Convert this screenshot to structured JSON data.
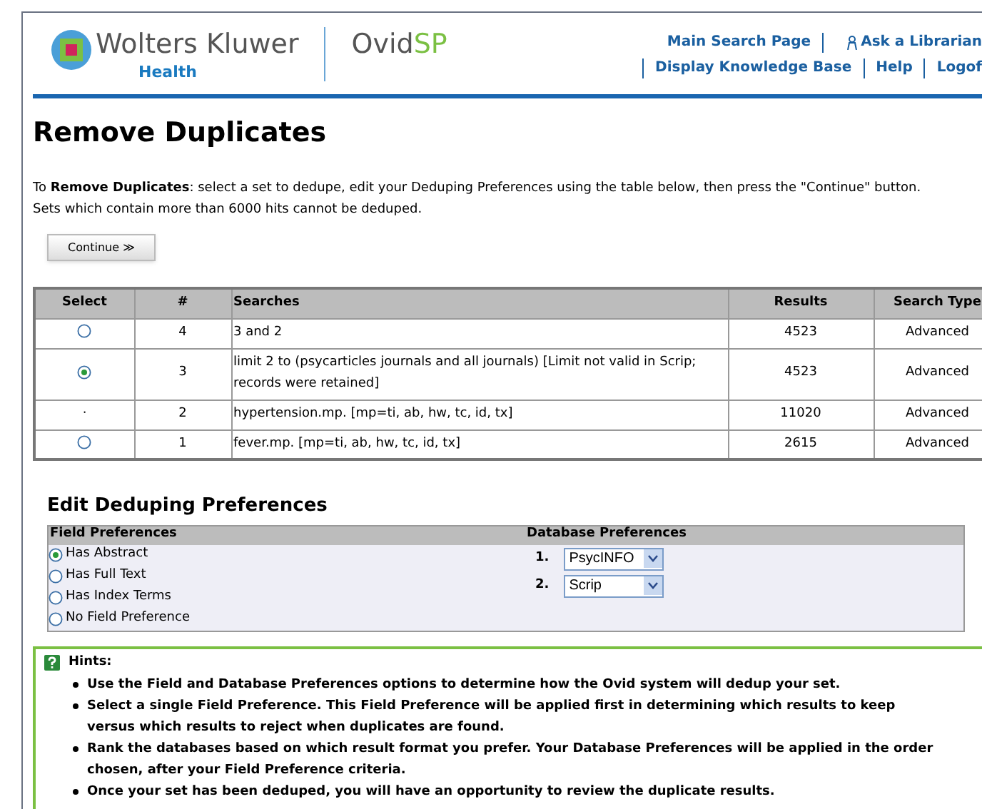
{
  "header": {
    "brand": "Wolters Kluwer",
    "division": "Health",
    "product_prefix": "Ovid",
    "product_suffix": "SP",
    "links_top": [
      "Main Search Page",
      "Ask a Librarian"
    ],
    "links_bottom": [
      "Display Knowledge Base",
      "Help",
      "Logof"
    ]
  },
  "title": "Remove Duplicates",
  "intro": "To **Remove Duplicates**: select a set to dedupe, edit your Deduping Preferences using the table below, then press the \"Continue\" button.",
  "note": "Sets which contain more than 6000 hits cannot be deduped.",
  "continue_button": "Continue ≫",
  "table": {
    "columns": [
      "Select",
      "#",
      "Searches",
      "Results",
      "Search Type"
    ],
    "rows": [
      {
        "kind": "radio",
        "selected": false,
        "number": "4",
        "search": "3 and 2",
        "results": "4523",
        "type": "Advanced"
      },
      {
        "kind": "radio",
        "selected": true,
        "number": "3",
        "search": "limit 2 to (psycarticles journals and all journals) [Limit not valid in Scrip; records were retained]",
        "results": "4523",
        "type": "Advanced"
      },
      {
        "kind": "mark",
        "mark": "·",
        "number": "2",
        "search": "hypertension.mp. [mp=ti, ab, hw, tc, id, tx]",
        "results": "11020",
        "type": "Advanced"
      },
      {
        "kind": "radio",
        "selected": false,
        "number": "1",
        "search": "fever.mp. [mp=ti, ab, hw, tc, id, tx]",
        "results": "2615",
        "type": "Advanced"
      }
    ]
  },
  "dedup": {
    "heading": "Edit Deduping Preferences",
    "field_heading": "Field Preferences",
    "database_heading": "Database Preferences",
    "fields": [
      {
        "label": "Has Abstract",
        "selected": true
      },
      {
        "label": "Has Full Text",
        "selected": false
      },
      {
        "label": "Has Index Terms",
        "selected": false
      },
      {
        "label": "No Field Preference",
        "selected": false
      }
    ],
    "databases": [
      {
        "rank": "1.",
        "value": "PsycINFO"
      },
      {
        "rank": "2.",
        "value": "Scrip"
      }
    ]
  },
  "hints": {
    "title": "Hints:",
    "items": [
      "Use the Field and Database Preferences options to determine how the Ovid system will dedup your set.",
      "Select a single Field Preference. This Field Preference will be applied first in determining which results to keep versus which results to reject when duplicates are found.",
      "Rank the databases based on which result format you prefer. Your Database Preferences will be applied in the order chosen, after your Field Preference criteria.",
      "Once your set has been deduped, you will have an opportunity to review the duplicate results."
    ]
  }
}
